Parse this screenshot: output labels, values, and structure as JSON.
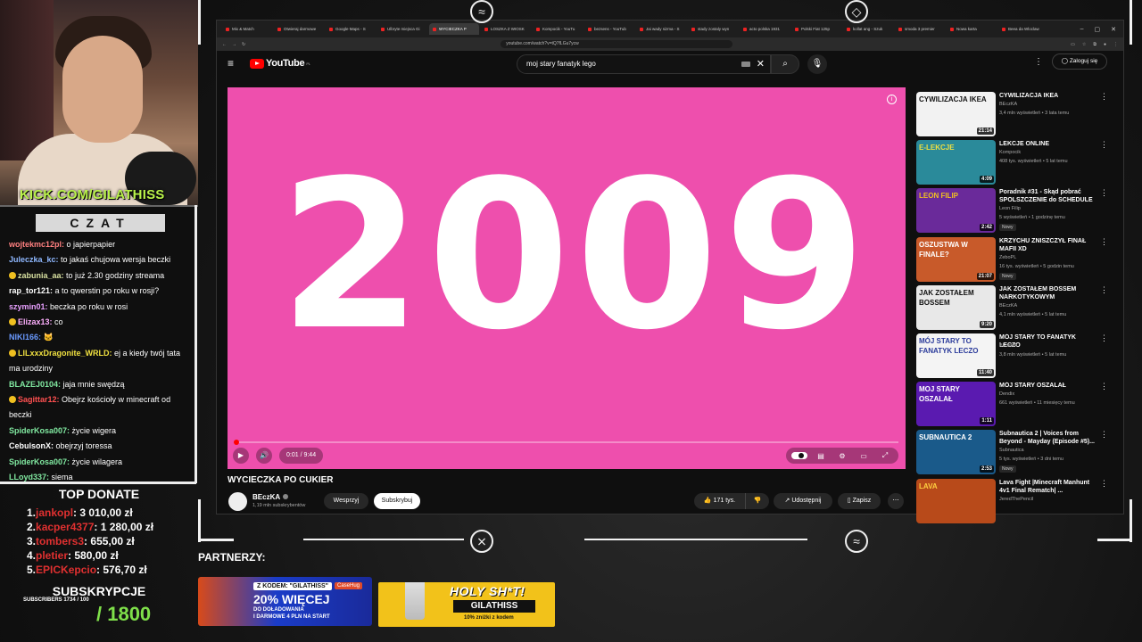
{
  "stream": {
    "kick_url": "KICK.COM/GILATHISS",
    "chat_title": "CZAT",
    "chat": [
      {
        "user": "wojtekmc12pl",
        "color": "#ff8080",
        "text": "o japierpapier",
        "emote": false
      },
      {
        "user": "Juleczka_kc",
        "color": "#8fb8ff",
        "text": "to jakaś chujowa wersja beczki",
        "emote": false
      },
      {
        "user": "zabunia_aa",
        "color": "#d8e0a0",
        "text": "to już 2.30 godziny streama",
        "emote": true
      },
      {
        "user": "rap_tor121",
        "color": "#ffffff",
        "text": "a to qwerstin po roku w rosji?",
        "emote": false
      },
      {
        "user": "szymin01",
        "color": "#e8a0ff",
        "text": "beczka po roku w rosi",
        "emote": false
      },
      {
        "user": "Elizax13",
        "color": "#ffb0ff",
        "text": "co",
        "emote": true
      },
      {
        "user": "NIKI166",
        "color": "#6a9aff",
        "text": "🐱",
        "emote": false
      },
      {
        "user": "LILxxxDragonite_WRLD",
        "color": "#f0e040",
        "text": "ej a kiedy twój tata ma urodziny",
        "emote": true
      },
      {
        "user": "BLAZEJ0104",
        "color": "#80e8a0",
        "text": "jaja mnie swędzą",
        "emote": false
      },
      {
        "user": "Sagittar12",
        "color": "#ff5050",
        "text": "Obejrz kościoły w minecraft od beczki",
        "emote": true
      },
      {
        "user": "SpiderKosa007",
        "color": "#80e8a0",
        "text": "życie wigera",
        "emote": false
      },
      {
        "user": "CebulsonX",
        "color": "#ffffff",
        "text": "obejrzyj toressa",
        "emote": false
      },
      {
        "user": "SpiderKosa007",
        "color": "#80e8a0",
        "text": "życie wilagera",
        "emote": false
      },
      {
        "user": "LLoyd337",
        "color": "#80e8a0",
        "text": "siema",
        "emote": false
      }
    ],
    "top_donate_title": "TOP DONATE",
    "donates": [
      {
        "rank": "1.",
        "name": "jankopl",
        "amount": "3 010,00 zł"
      },
      {
        "rank": "2.",
        "name": "kacper4377",
        "amount": "1 280,00 zł"
      },
      {
        "rank": "3.",
        "name": "tombers3",
        "amount": "655,00 zł"
      },
      {
        "rank": "4.",
        "name": "pletier",
        "amount": "580,00 zł"
      },
      {
        "rank": "5.",
        "name": "EPICKepcio",
        "amount": "576,70 zł"
      }
    ],
    "subs_title": "SUBSKRYPCJE",
    "subs_small": "SUBSCRIBERS 1734 / 100",
    "subs_goal": "/ 1800",
    "partners_label": "PARTNERZY:",
    "banner1": {
      "code": "Z KODEM: \"GILATHISS\"",
      "big": "20% WIĘCEJ",
      "line2": "DO DOŁADOWANIA",
      "line3": "I DARMOWE 4 PLN NA START",
      "brand": "CaseHug"
    },
    "banner2": {
      "big": "HOLY SH*T!",
      "name": "GILATHISS",
      "sub": "10% zniżki z kodem"
    }
  },
  "browser": {
    "tabs": [
      "Mix & Match",
      "Otwieraj darmowe",
      "Google Maps - S",
      "Ulbryte miejsca Gi",
      "WYCIECZKA P",
      "LOSZKA Z WIOSK",
      "Kompocik - YouTu",
      "bezsens - YouTub",
      "Jai wady sizma - S",
      "stady zostaly wyn",
      "acto polska 1931",
      "Polski Fiat 125p",
      "kollat ang - Szuk",
      "smoda 3 premier",
      "Nowa karta",
      "Beea da Wloclaw"
    ],
    "active_tab": 4,
    "url": "youtube.com/watch?v=tQ7fLGu7ycw"
  },
  "youtube": {
    "logo": "YouTube",
    "region": "PL",
    "search_value": "moj stary fanatyk lego",
    "login": "Zaloguj się",
    "video_year": "2009",
    "time": "0:01 / 9:44",
    "progress": 0.002,
    "title": "WYCIECZKA PO CUKIER",
    "channel": "BEczKA",
    "subscribers": "1,19 mln subskrybentów",
    "support": "Wesprzyj",
    "subscribe": "Subskrybuj",
    "likes": "171 tys.",
    "share": "Udostępnij",
    "save": "Zapisz",
    "recommendations": [
      {
        "title": "CYWILIZACJA IKEA",
        "channel": "BEczKA",
        "meta": "3,4 mln wyświetleń • 3 lata temu",
        "dur": "21:14",
        "thumb": "CYWILIZACJA IKEA",
        "bg": "#f2f2f2",
        "fg": "#111",
        "nowy": ""
      },
      {
        "title": "LEKCJE ONLINE",
        "channel": "Kompocik",
        "meta": "408 tys. wyświetleń • 5 lat temu",
        "dur": "4:09",
        "thumb": "E-LEKCJE",
        "bg": "#2a8a9a",
        "fg": "#f0e040",
        "nowy": ""
      },
      {
        "title": "Poradnik #31 - Skąd pobrać SPOLSZCZENIE do SCHEDULE I ...",
        "channel": "Leon Filip",
        "meta": "5 wyświetleń • 1 godzinę temu",
        "dur": "2:42",
        "thumb": "LEON FILIP",
        "bg": "#6a2a9a",
        "fg": "#f0c020",
        "nowy": "Nowy"
      },
      {
        "title": "KRZYCHU ZNISZCZYŁ FINAŁ MAFII XD",
        "channel": "ZeboPL",
        "meta": "16 tys. wyświetleń • 5 godzin temu",
        "dur": "21:07",
        "thumb": "OSZUSTWA W FINALE?",
        "bg": "#c85a2a",
        "fg": "#fff",
        "nowy": "Nowy"
      },
      {
        "title": "JAK ZOSTAŁEM BOSSEM NARKOTYKOWYM",
        "channel": "BEczKA",
        "meta": "4,1 mln wyświetleń • 5 lat temu",
        "dur": "9:20",
        "thumb": "JAK ZOSTAŁEM BOSSEM",
        "bg": "#e8e8e8",
        "fg": "#111",
        "nowy": ""
      },
      {
        "title": "MÓJ STARY TO FANATYK LECZO",
        "channel": "BEczKA",
        "meta": "3,8 mln wyświetleń • 5 lat temu",
        "dur": "11:40",
        "thumb": "MÓJ STARY TO FANATYK LECZO",
        "bg": "#f4f4f4",
        "fg": "#2a3a9a",
        "nowy": ""
      },
      {
        "title": "MÓJ STARY OSZALAŁ",
        "channel": "Dendix",
        "meta": "661 wyświetleń • 11 miesięcy temu",
        "dur": "1:11",
        "thumb": "MOJ STARY OSZALAŁ",
        "bg": "#5a1ab0",
        "fg": "#fff",
        "nowy": ""
      },
      {
        "title": "Subnautica 2 | Voices from Beyond - Mayday (Episode #5)...",
        "channel": "Subnautica",
        "meta": "5 tys. wyświetleń • 3 dni temu",
        "dur": "2:53",
        "thumb": "SUBNAUTICA 2",
        "bg": "#1a5a8a",
        "fg": "#fff",
        "nowy": "Nowy"
      },
      {
        "title": "Lava Fight |Minecraft Manhunt 4v1 Final Rematch| ...",
        "channel": "JeredThePencil",
        "meta": "",
        "dur": "",
        "thumb": "LAVA",
        "bg": "#b84a1a",
        "fg": "#ffd040",
        "nowy": ""
      }
    ]
  }
}
